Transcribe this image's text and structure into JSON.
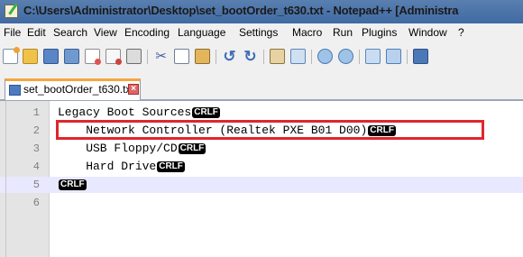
{
  "window": {
    "title": "C:\\Users\\Administrator\\Desktop\\set_bootOrder_t630.txt - Notepad++ [Administra"
  },
  "menu": {
    "items": [
      "File",
      "Edit",
      "Search",
      "View",
      "Encoding",
      "Language",
      "Settings",
      "Macro",
      "Run",
      "Plugins",
      "Window",
      "?"
    ]
  },
  "toolbar": {
    "icons": [
      "new-file-icon",
      "open-file-icon",
      "save-icon",
      "save-all-icon",
      "close-icon",
      "close-all-icon",
      "print-icon",
      "cut-icon",
      "copy-icon",
      "paste-icon",
      "undo-icon",
      "redo-icon",
      "find-icon",
      "replace-icon",
      "zoom-in-icon",
      "zoom-out-icon",
      "sync-vertical-icon",
      "sync-horizontal-icon",
      "word-wrap-icon"
    ]
  },
  "tab": {
    "label": "set_bootOrder_t630.txt"
  },
  "editor": {
    "eol_marker": "CRLF",
    "current_line": 5,
    "lines": [
      {
        "number": "1",
        "text": "Legacy Boot Sources",
        "eol": true
      },
      {
        "number": "2",
        "text": "    Network Controller (Realtek PXE B01 D00)",
        "eol": true
      },
      {
        "number": "3",
        "text": "    USB Floppy/CD",
        "eol": true
      },
      {
        "number": "4",
        "text": "    Hard Drive",
        "eol": true
      },
      {
        "number": "5",
        "text": "",
        "eol": true
      },
      {
        "number": "6",
        "text": "",
        "eol": false
      }
    ]
  },
  "colors": {
    "highlight_box": "#e0262d",
    "current_line_bg": "#e8e8ff",
    "tab_accent": "#f4a640"
  }
}
